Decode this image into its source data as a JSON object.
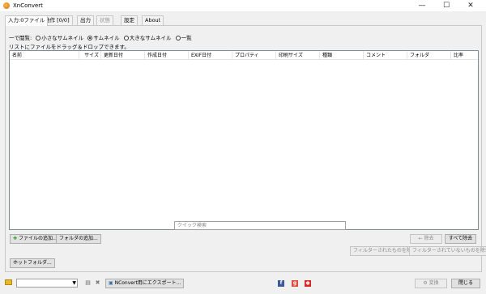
{
  "window": {
    "title": "XnConvert",
    "minimize": "—",
    "maximize": "☐",
    "close": "✕"
  },
  "tabs": [
    {
      "label": "入力:0ファイル",
      "active": true
    },
    {
      "label": "動作 [0/0]"
    },
    {
      "label": "出力"
    },
    {
      "label": "状態",
      "disabled": true
    },
    {
      "label": "設定"
    },
    {
      "label": "About"
    }
  ],
  "input": {
    "view_prefix": "一で閲覧:",
    "view_options": [
      "小さなサムネイル",
      "サムネイル",
      "大きなサムネイル",
      "一覧"
    ],
    "selected_view": "サムネイル",
    "hint": "リストにファイルをドラッグ＆ドロップできます。",
    "columns": [
      "名前",
      "サイズ",
      "更新日付",
      "作成日付",
      "EXIF日付",
      "プロパティ",
      "印刷サイズ",
      "種類",
      "コメント",
      "フォルダ",
      "比率"
    ],
    "buttons": {
      "add_files": "ファイルの追加...",
      "add_folder": "フォルダの追加...",
      "remove": "除去",
      "remove_all": "すべて除去",
      "remove_filtered": "フィルターされたものを除去",
      "remove_unfiltered": "フィルターされていないものを除去",
      "hot_folder": "ホットフォルダ..."
    },
    "search_placeholder": "クイック検索"
  },
  "bottom": {
    "export_button": "NConvert用にエクスポート...",
    "convert_button": "変換",
    "close_button": "閉じる"
  },
  "icons": {
    "folder": "folder-icon",
    "save": "save-icon",
    "delete": "delete-icon",
    "facebook": "facebook-icon",
    "google": "google-plus-icon",
    "gift": "gift-icon"
  }
}
